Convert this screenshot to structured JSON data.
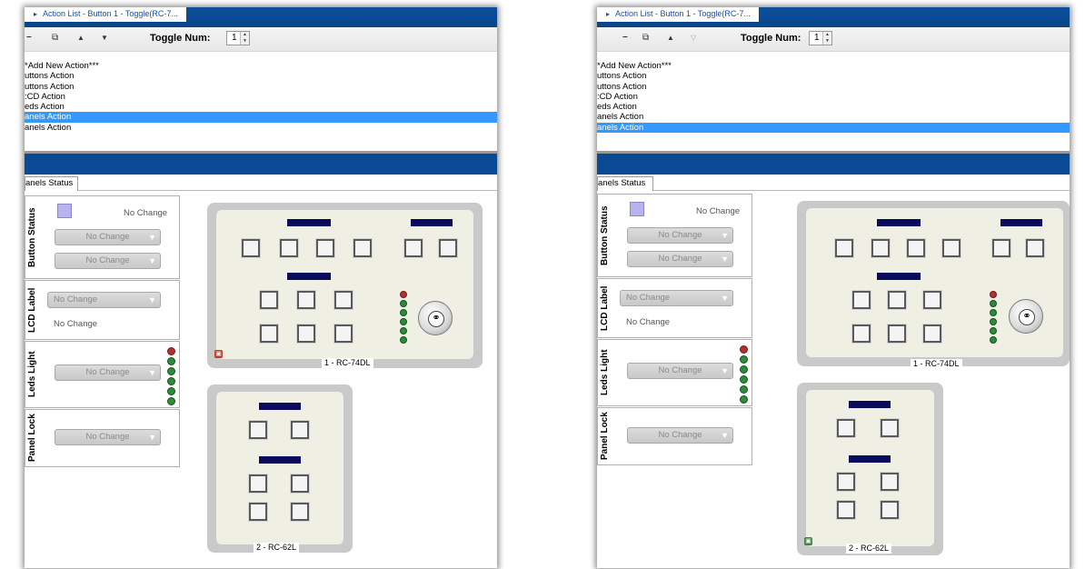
{
  "colors": {
    "accent_blue": "#0a4a95",
    "selection": "#3399ff",
    "swatch": "#b8b3ee",
    "led_green": "#2e8b3a",
    "led_red": "#b33030",
    "panel_label": "#0b0b5e"
  },
  "left": {
    "title_tab": "Action List - Button 1 - Toggle(RC-7...",
    "toolbar": {
      "minus_icon": "−",
      "copy_icon": "⧉",
      "up_icon": "▲",
      "down_icon": "▼",
      "toggle_label": "Toggle Num:",
      "toggle_value": "1"
    },
    "actions": [
      "*Add New Action***",
      "uttons Action",
      "uttons Action",
      ":CD Action",
      "eds Action",
      "anels Action",
      "anels Action"
    ],
    "selected_index": 5,
    "tab_label": "anels Status",
    "button_status": {
      "title": "Button Status",
      "text": "No Change",
      "dd1": "No Change",
      "dd2": "No Change"
    },
    "lcd_label": {
      "title": "LCD Label",
      "dd": "No Change",
      "text": "No Change"
    },
    "leds_light": {
      "title": "Leds Light",
      "dd": "No Change"
    },
    "panel_lock": {
      "title": "Panel Lock",
      "dd": "No Change"
    },
    "panel1_caption": "1 - RC-74DL",
    "panel2_caption": "2 - RC-62L"
  },
  "right": {
    "title_tab": "Action List - Button 1 - Toggle(RC-7...",
    "toolbar": {
      "minus_icon": "−",
      "copy_icon": "⧉",
      "up_icon": "▲",
      "down_icon": "▽",
      "toggle_label": "Toggle Num:",
      "toggle_value": "1"
    },
    "actions": [
      "*Add New Action***",
      "uttons Action",
      "uttons Action",
      ":CD Action",
      "eds Action",
      "anels Action",
      "anels Action"
    ],
    "selected_index": 6,
    "tab_label": "anels Status",
    "button_status": {
      "title": "Button Status",
      "text": "No Change",
      "dd1": "No Change",
      "dd2": "No Change"
    },
    "lcd_label": {
      "title": "LCD Label",
      "dd": "No Change",
      "text": "No Change"
    },
    "leds_light": {
      "title": "Leds Light",
      "dd": "No Change"
    },
    "panel_lock": {
      "title": "Panel Lock",
      "dd": "No Change"
    },
    "panel1_caption": "1 - RC-74DL",
    "panel2_caption": "2 - RC-62L"
  }
}
